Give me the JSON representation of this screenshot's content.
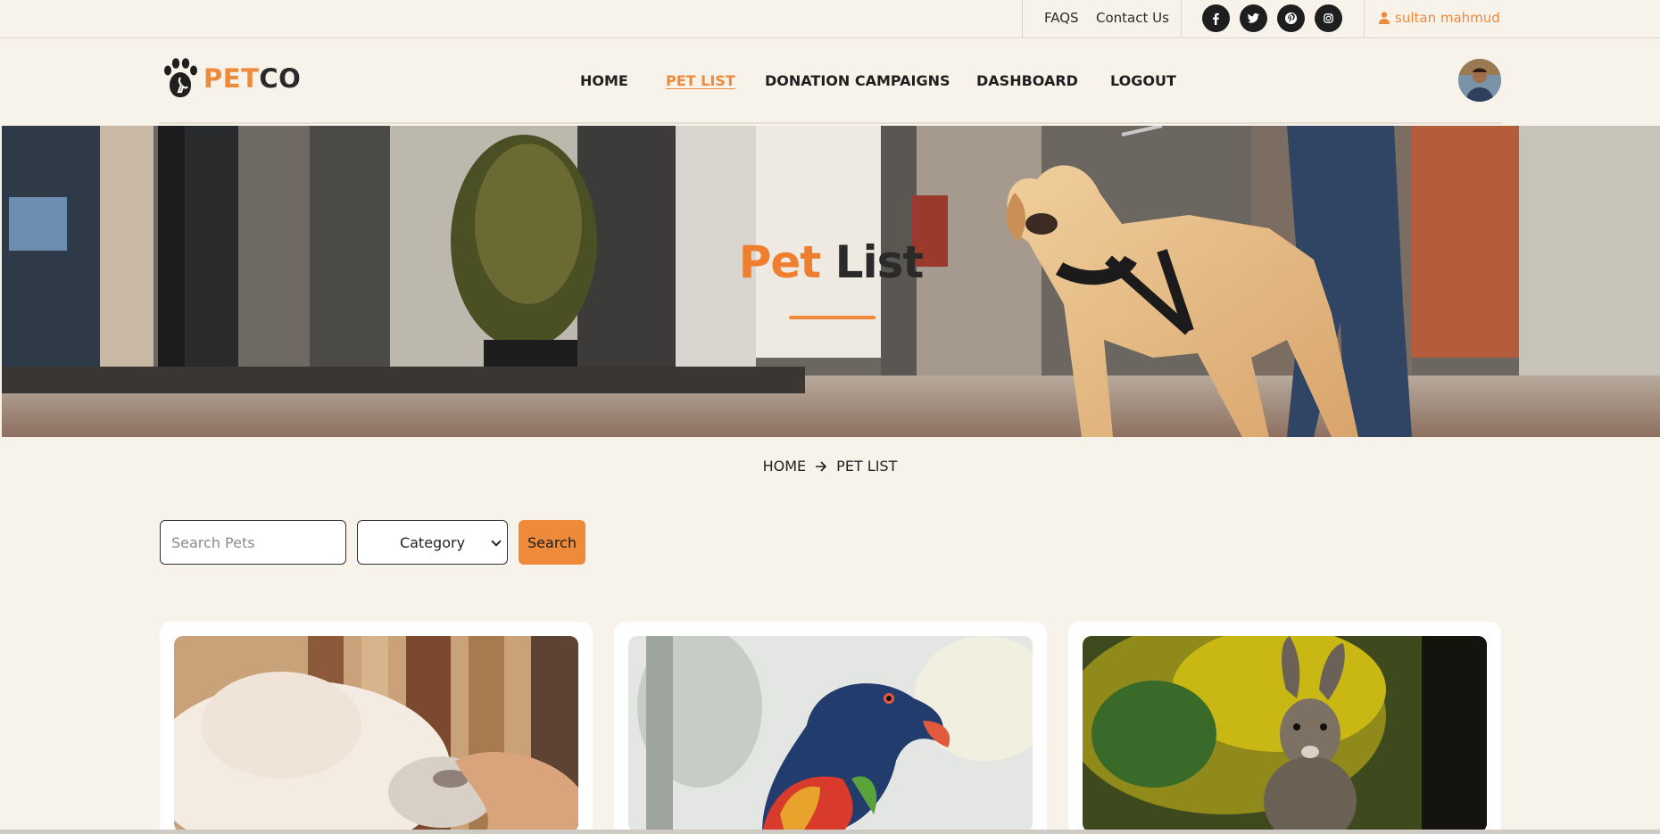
{
  "topbar": {
    "faqs": "FAQS",
    "contact": "Contact Us",
    "social": [
      "facebook-icon",
      "twitter-icon",
      "pinterest-icon",
      "instagram-icon"
    ],
    "user_name": "sultan mahmud"
  },
  "header": {
    "logo_pet": "PET",
    "logo_co": "CO",
    "nav": [
      "HOME",
      "PET LIST",
      "DONATION CAMPAIGNS",
      "DASHBOARD",
      "LOGOUT"
    ],
    "active_nav": "PET LIST"
  },
  "banner": {
    "title_part1": "Pet",
    "title_part2": "List"
  },
  "breadcrumb": {
    "home": "HOME",
    "current": "PET LIST"
  },
  "filters": {
    "search_placeholder": "Search Pets",
    "category_label": "Category",
    "search_button": "Search"
  },
  "cards": [
    {
      "image": "white-cat-photo"
    },
    {
      "image": "parrot-photo"
    },
    {
      "image": "rabbit-photo"
    }
  ],
  "colors": {
    "accent": "#ef8a3b",
    "background": "#f7f2ea",
    "dark": "#1f1f1f"
  }
}
